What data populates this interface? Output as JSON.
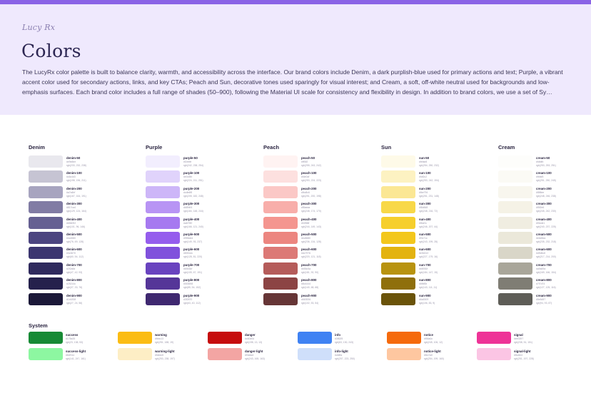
{
  "header": {
    "logo_text": "Lucy Rx",
    "title": "Colors",
    "description": "The LucyRx color palette is built to balance clarity, warmth, and accessibility across the interface. Our brand colors include Denim, a dark purplish-blue used for primary actions and text; Purple, a vibrant accent color used for secondary actions, links, and key CTAs; Peach and Sun, decorative tones used sparingly for visual interest; and Cream, a soft, off-white neutral used for backgrounds and low-emphasis surfaces. Each brand color includes a full range of shades (50–900), following the Material UI scale for consistency and flexibility in design. In addition to brand colors, we use a set of Sy…"
  },
  "theme": {
    "accent": "#8a63e6",
    "header_bg": "#efe9fd"
  },
  "palettes": [
    {
      "title": "Denim",
      "shades": [
        {
          "name": "denim-50",
          "color": "#e9e8ee"
        },
        {
          "name": "denim-100",
          "color": "#c6c4d3"
        },
        {
          "name": "denim-200",
          "color": "#a7a4bf"
        },
        {
          "name": "denim-300",
          "color": "#817ca4"
        },
        {
          "name": "denim-400",
          "color": "#656092"
        },
        {
          "name": "denim-500",
          "color": "#4c4580"
        },
        {
          "name": "denim-600",
          "color": "#3c3670"
        },
        {
          "name": "denim-700",
          "color": "#2f2a5d"
        },
        {
          "name": "denim-800",
          "color": "#25214c"
        },
        {
          "name": "denim-900",
          "color": "#1b1838"
        }
      ]
    },
    {
      "title": "Purple",
      "shades": [
        {
          "name": "purple-50",
          "color": "#f2eefe"
        },
        {
          "name": "purple-100",
          "color": "#e0d3fb"
        },
        {
          "name": "purple-200",
          "color": "#cdb6f8"
        },
        {
          "name": "purple-300",
          "color": "#b894f4"
        },
        {
          "name": "purple-400",
          "color": "#a679f0"
        },
        {
          "name": "purple-500",
          "color": "#955ded"
        },
        {
          "name": "purple-600",
          "color": "#8051dc"
        },
        {
          "name": "purple-700",
          "color": "#6943bf"
        },
        {
          "name": "purple-800",
          "color": "#553698"
        },
        {
          "name": "purple-900",
          "color": "#3f2870"
        }
      ]
    },
    {
      "title": "Peach",
      "shades": [
        {
          "name": "peach-50",
          "color": "#fff3f2"
        },
        {
          "name": "peach-100",
          "color": "#fde0df"
        },
        {
          "name": "peach-200",
          "color": "#fbc8c6"
        },
        {
          "name": "peach-300",
          "color": "#f8aeaa"
        },
        {
          "name": "peach-400",
          "color": "#f4958f"
        },
        {
          "name": "peach-500",
          "color": "#ec8680"
        },
        {
          "name": "peach-600",
          "color": "#dc7976"
        },
        {
          "name": "peach-700",
          "color": "#b55c5a"
        },
        {
          "name": "peach-800",
          "color": "#8c4444"
        },
        {
          "name": "peach-900",
          "color": "#663536"
        }
      ]
    },
    {
      "title": "Sun",
      "shades": [
        {
          "name": "sun-50",
          "color": "#fefae8"
        },
        {
          "name": "sun-100",
          "color": "#fdf2c2"
        },
        {
          "name": "sun-200",
          "color": "#fbe794"
        },
        {
          "name": "sun-300",
          "color": "#f8d848"
        },
        {
          "name": "sun-400",
          "color": "#f6cf2c"
        },
        {
          "name": "sun-500",
          "color": "#f3c71c"
        },
        {
          "name": "sun-600",
          "color": "#e3b310"
        },
        {
          "name": "sun-700",
          "color": "#b8930f"
        },
        {
          "name": "sun-800",
          "color": "#8f6f0b"
        },
        {
          "name": "sun-900",
          "color": "#6a5309"
        }
      ]
    },
    {
      "title": "Cream",
      "shades": [
        {
          "name": "cream-50",
          "color": "#fdfdfb"
        },
        {
          "name": "cream-100",
          "color": "#fbfaf5"
        },
        {
          "name": "cream-200",
          "color": "#f8f6ee"
        },
        {
          "name": "cream-300",
          "color": "#f5f2e6"
        },
        {
          "name": "cream-400",
          "color": "#f0ede1"
        },
        {
          "name": "cream-500",
          "color": "#ebe8da"
        },
        {
          "name": "cream-600",
          "color": "#d9d6c8"
        },
        {
          "name": "cream-700",
          "color": "#a9a69a"
        },
        {
          "name": "cream-800",
          "color": "#7f7d74"
        },
        {
          "name": "cream-900",
          "color": "#5e5d57"
        }
      ]
    }
  ],
  "system": {
    "title": "System",
    "items": [
      {
        "name": "success",
        "color": "#178a35"
      },
      {
        "name": "warning",
        "color": "#fbbc13"
      },
      {
        "name": "danger",
        "color": "#c60d0d"
      },
      {
        "name": "info",
        "color": "#3f82f3"
      },
      {
        "name": "notice",
        "color": "#f56a0c"
      },
      {
        "name": "signal",
        "color": "#ee3397"
      },
      {
        "name": "success-light",
        "color": "#8df7a1"
      },
      {
        "name": "warning-light",
        "color": "#fdeec5"
      },
      {
        "name": "danger-light",
        "color": "#f3a5a3"
      },
      {
        "name": "info-light",
        "color": "#cfdffa"
      },
      {
        "name": "notice-light",
        "color": "#fec7a0"
      },
      {
        "name": "signal-light",
        "color": "#fbc5e4"
      }
    ]
  }
}
